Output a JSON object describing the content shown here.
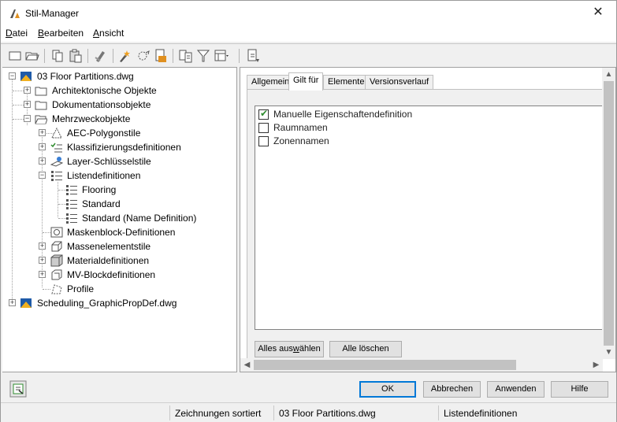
{
  "window": {
    "title": "Stil-Manager",
    "close_glyph": "✕"
  },
  "menu": {
    "items": [
      {
        "pre": "",
        "ul": "D",
        "post": "atei"
      },
      {
        "pre": "",
        "ul": "B",
        "post": "earbeiten"
      },
      {
        "pre": "",
        "ul": "A",
        "post": "nsicht"
      }
    ]
  },
  "toolbar": {
    "icons": [
      "new-icon",
      "open-icon",
      "copy-icon",
      "paste-icon",
      "purge-icon",
      "edit-style-icon",
      "sort-icon",
      "import-icon",
      "compare-icon",
      "filter-icon",
      "view-options-icon",
      "synchronize-icon"
    ]
  },
  "tree": {
    "rows": [
      {
        "label": "03 Floor Partitions.dwg",
        "icon": "drawing-icon"
      },
      {
        "label": "Architektonische Objekte",
        "icon": "folder-icon"
      },
      {
        "label": "Dokumentationsobjekte",
        "icon": "folder-icon"
      },
      {
        "label": "Mehrzweckobjekte",
        "icon": "folder-open-icon"
      },
      {
        "label": "AEC-Polygonstile",
        "icon": "polygon-style-icon"
      },
      {
        "label": "Klassifizierungsdefinitionen",
        "icon": "classification-icon"
      },
      {
        "label": "Layer-Schlüsselstile",
        "icon": "layer-key-icon"
      },
      {
        "label": "Listendefinitionen",
        "icon": "list-definition-icon"
      },
      {
        "label": "Flooring",
        "icon": "list-item-icon"
      },
      {
        "label": "Standard",
        "icon": "list-item-icon"
      },
      {
        "label": "Standard (Name Definition)",
        "icon": "list-item-icon"
      },
      {
        "label": "Maskenblock-Definitionen",
        "icon": "mask-block-icon"
      },
      {
        "label": "Massenelementstile",
        "icon": "mass-element-icon"
      },
      {
        "label": "Materialdefinitionen",
        "icon": "material-icon"
      },
      {
        "label": "MV-Blockdefinitionen",
        "icon": "mv-block-icon"
      },
      {
        "label": "Profile",
        "icon": "profile-icon"
      },
      {
        "label": "Scheduling_GraphicPropDef.dwg",
        "icon": "drawing-icon"
      }
    ]
  },
  "tabs": [
    {
      "label": "Allgemein"
    },
    {
      "label": "Gilt für"
    },
    {
      "label": "Elemente"
    },
    {
      "label": "Versionsverlauf"
    }
  ],
  "applies_to": {
    "items": [
      {
        "label": "Manuelle Eigenschaftendefinition",
        "checked": true
      },
      {
        "label": "Raumnamen",
        "checked": false
      },
      {
        "label": "Zonennamen",
        "checked": false
      }
    ],
    "select_all_pre": "Alles aus",
    "select_all_ul": "w",
    "select_all_post": "ählen",
    "clear_all": "Alle löschen"
  },
  "dialog_buttons": {
    "ok": "OK",
    "cancel": "Abbrechen",
    "apply": "Anwenden",
    "help": "Hilfe"
  },
  "status": {
    "sort": "Zeichnungen sortiert",
    "drawing": "03 Floor Partitions.dwg",
    "selection": "Listendefinitionen"
  },
  "colors": {
    "accent": "#0078d7",
    "check": "#2e8b2e"
  }
}
